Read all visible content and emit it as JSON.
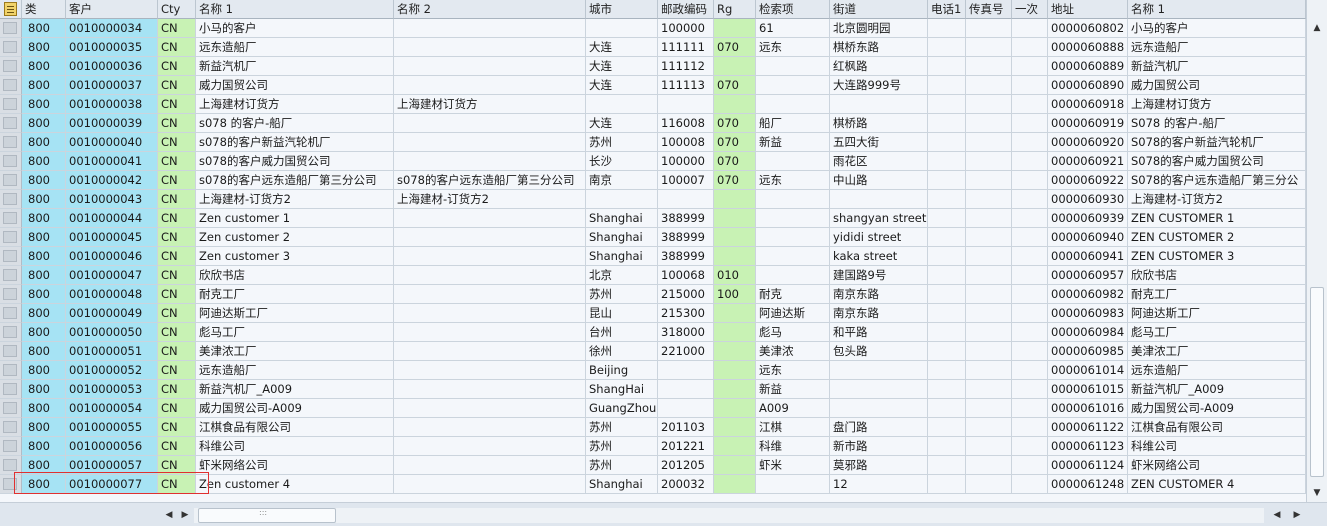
{
  "columns": [
    "类",
    "客户",
    "Cty",
    "名称 1",
    "名称 2",
    "城市",
    "邮政编码",
    "Rg",
    "检索项",
    "街道",
    "电话1",
    "传真号",
    "一次",
    "地址",
    "名称 1"
  ],
  "rows": [
    [
      "800",
      "0010000034",
      "CN",
      "小马的客户",
      "",
      "",
      "100000",
      "",
      "61",
      "北京圆明园",
      "",
      "",
      "",
      "0000060802",
      "小马的客户"
    ],
    [
      "800",
      "0010000035",
      "CN",
      "远东造船厂",
      "",
      "大连",
      "111111",
      "070",
      "远东",
      "棋桥东路",
      "",
      "",
      "",
      "0000060888",
      "远东造船厂"
    ],
    [
      "800",
      "0010000036",
      "CN",
      "新益汽机厂",
      "",
      "大连",
      "111112",
      "",
      "",
      "红枫路",
      "",
      "",
      "",
      "0000060889",
      "新益汽机厂"
    ],
    [
      "800",
      "0010000037",
      "CN",
      "威力国贸公司",
      "",
      "大连",
      "111113",
      "070",
      "",
      "大连路999号",
      "",
      "",
      "",
      "0000060890",
      "威力国贸公司"
    ],
    [
      "800",
      "0010000038",
      "CN",
      "上海建材订货方",
      "上海建材订货方",
      "",
      "",
      "",
      "",
      "",
      "",
      "",
      "",
      "0000060918",
      "上海建材订货方"
    ],
    [
      "800",
      "0010000039",
      "CN",
      "s078 的客户-船厂",
      "",
      "大连",
      "116008",
      "070",
      "船厂",
      "棋桥路",
      "",
      "",
      "",
      "0000060919",
      "S078 的客户-船厂"
    ],
    [
      "800",
      "0010000040",
      "CN",
      "s078的客户新益汽轮机厂",
      "",
      "苏州",
      "100008",
      "070",
      "新益",
      "五四大街",
      "",
      "",
      "",
      "0000060920",
      "S078的客户新益汽轮机厂"
    ],
    [
      "800",
      "0010000041",
      "CN",
      "s078的客户威力国贸公司",
      "",
      "长沙",
      "100000",
      "070",
      "",
      "雨花区",
      "",
      "",
      "",
      "0000060921",
      "S078的客户威力国贸公司"
    ],
    [
      "800",
      "0010000042",
      "CN",
      "s078的客户远东造船厂第三分公司",
      "s078的客户远东造船厂第三分公司",
      "南京",
      "100007",
      "070",
      "远东",
      "中山路",
      "",
      "",
      "",
      "0000060922",
      "S078的客户远东造船厂第三分公"
    ],
    [
      "800",
      "0010000043",
      "CN",
      "上海建材-订货方2",
      "上海建材-订货方2",
      "",
      "",
      "",
      "",
      "",
      "",
      "",
      "",
      "0000060930",
      "上海建材-订货方2"
    ],
    [
      "800",
      "0010000044",
      "CN",
      "Zen customer 1",
      "",
      "Shanghai",
      "388999",
      "",
      "",
      "shangyan street",
      "",
      "",
      "",
      "0000060939",
      "ZEN CUSTOMER 1"
    ],
    [
      "800",
      "0010000045",
      "CN",
      "Zen customer 2",
      "",
      "Shanghai",
      "388999",
      "",
      "",
      "yididi street",
      "",
      "",
      "",
      "0000060940",
      "ZEN CUSTOMER 2"
    ],
    [
      "800",
      "0010000046",
      "CN",
      "Zen customer 3",
      "",
      "Shanghai",
      "388999",
      "",
      "",
      "kaka street",
      "",
      "",
      "",
      "0000060941",
      "ZEN CUSTOMER 3"
    ],
    [
      "800",
      "0010000047",
      "CN",
      "欣欣书店",
      "",
      "北京",
      "100068",
      "010",
      "",
      "建国路9号",
      "",
      "",
      "",
      "0000060957",
      "欣欣书店"
    ],
    [
      "800",
      "0010000048",
      "CN",
      "耐克工厂",
      "",
      "苏州",
      "215000",
      "100",
      "耐克",
      "南京东路",
      "",
      "",
      "",
      "0000060982",
      "耐克工厂"
    ],
    [
      "800",
      "0010000049",
      "CN",
      "阿迪达斯工厂",
      "",
      "昆山",
      "215300",
      "",
      "阿迪达斯",
      "南京东路",
      "",
      "",
      "",
      "0000060983",
      "阿迪达斯工厂"
    ],
    [
      "800",
      "0010000050",
      "CN",
      "彪马工厂",
      "",
      "台州",
      "318000",
      "",
      "彪马",
      "和平路",
      "",
      "",
      "",
      "0000060984",
      "彪马工厂"
    ],
    [
      "800",
      "0010000051",
      "CN",
      "美津浓工厂",
      "",
      "徐州",
      "221000",
      "",
      "美津浓",
      "包头路",
      "",
      "",
      "",
      "0000060985",
      "美津浓工厂"
    ],
    [
      "800",
      "0010000052",
      "CN",
      "远东造船厂",
      "",
      "Beijing",
      "",
      "",
      "远东",
      "",
      "",
      "",
      "",
      "0000061014",
      "远东造船厂"
    ],
    [
      "800",
      "0010000053",
      "CN",
      "新益汽机厂_A009",
      "",
      "ShangHai",
      "",
      "",
      "新益",
      "",
      "",
      "",
      "",
      "0000061015",
      "新益汽机厂_A009"
    ],
    [
      "800",
      "0010000054",
      "CN",
      "威力国贸公司-A009",
      "",
      "GuangZhou",
      "",
      "",
      "A009",
      "",
      "",
      "",
      "",
      "0000061016",
      "威力国贸公司-A009"
    ],
    [
      "800",
      "0010000055",
      "CN",
      "江棋食品有限公司",
      "",
      "苏州",
      "201103",
      "",
      "江棋",
      "盘门路",
      "",
      "",
      "",
      "0000061122",
      "江棋食品有限公司"
    ],
    [
      "800",
      "0010000056",
      "CN",
      "科维公司",
      "",
      "苏州",
      "201221",
      "",
      "科维",
      "新市路",
      "",
      "",
      "",
      "0000061123",
      "科维公司"
    ],
    [
      "800",
      "0010000057",
      "CN",
      "虾米网络公司",
      "",
      "苏州",
      "201205",
      "",
      "虾米",
      "莫邪路",
      "",
      "",
      "",
      "0000061124",
      "虾米网络公司"
    ],
    [
      "800",
      "0010000077",
      "CN",
      "Zen customer 4",
      "",
      "Shanghai",
      "200032",
      "",
      "",
      "12",
      "",
      "",
      "",
      "0000061248",
      "ZEN CUSTOMER 4"
    ]
  ]
}
